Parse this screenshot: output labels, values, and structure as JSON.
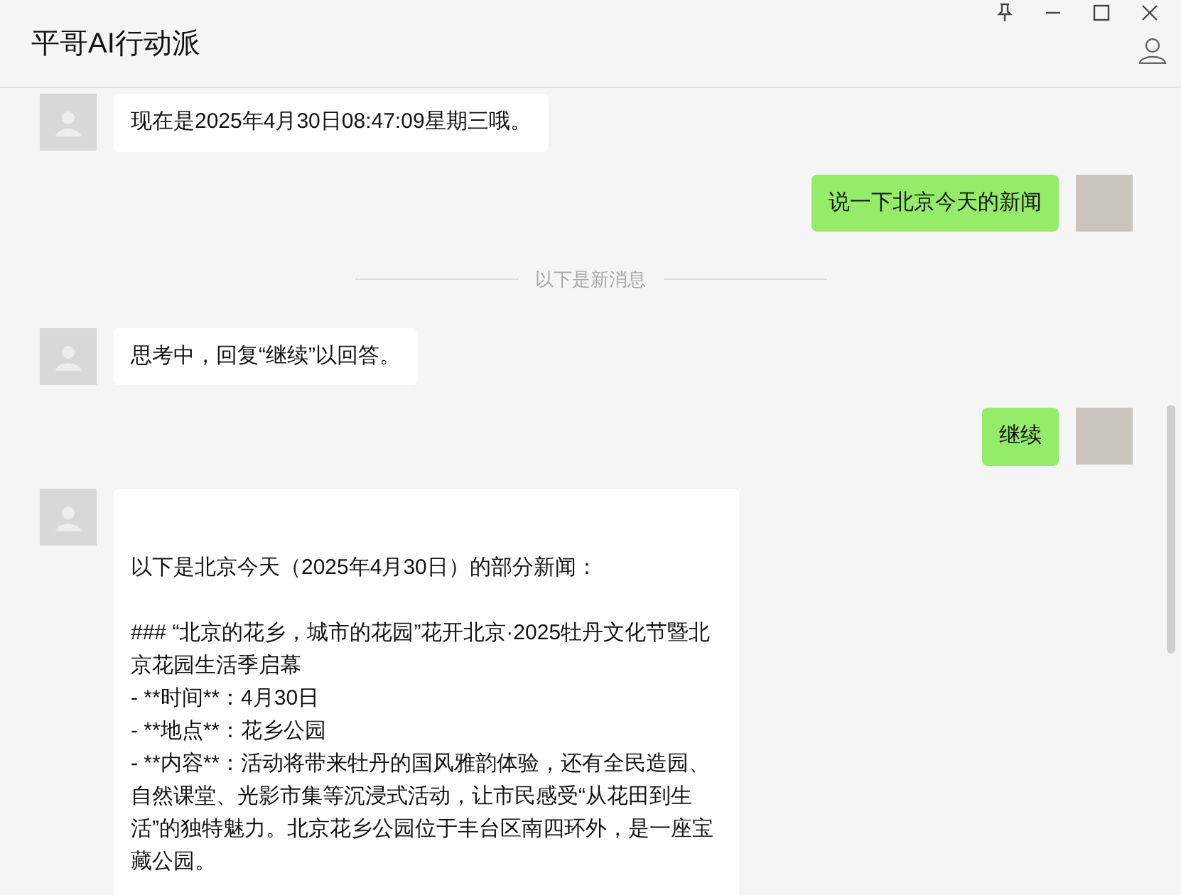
{
  "window": {
    "title": "平哥AI行动派"
  },
  "messages": [
    {
      "kind": "received",
      "paragraphs": [
        "现在是2025年4月30日08:47:09星期三哦。"
      ]
    },
    {
      "kind": "sent",
      "paragraphs": [
        "说一下北京今天的新闻"
      ]
    },
    {
      "kind": "divider",
      "paragraphs": [
        "以下是新消息"
      ]
    },
    {
      "kind": "received",
      "paragraphs": [
        "思考中，回复“继续”以回答。"
      ]
    },
    {
      "kind": "sent",
      "paragraphs": [
        "继续"
      ]
    },
    {
      "kind": "received",
      "paragraphs": [
        "以下是北京今天（2025年4月30日）的部分新闻：",
        "### “北京的花乡，城市的花园”花开北京·2025牡丹文化节暨北京花园生活季启幕\n- **时间**：4月30日\n- **地点**：花乡公园\n- **内容**：活动将带来牡丹的国风雅韵体验，还有全民造园、自然课堂、光影市集等沉浸式活动，让市民感受“从花田到生活”的独特魅力。北京花乡公园位于丰台区南四环外，是一座宝藏公园。"
      ]
    }
  ]
}
